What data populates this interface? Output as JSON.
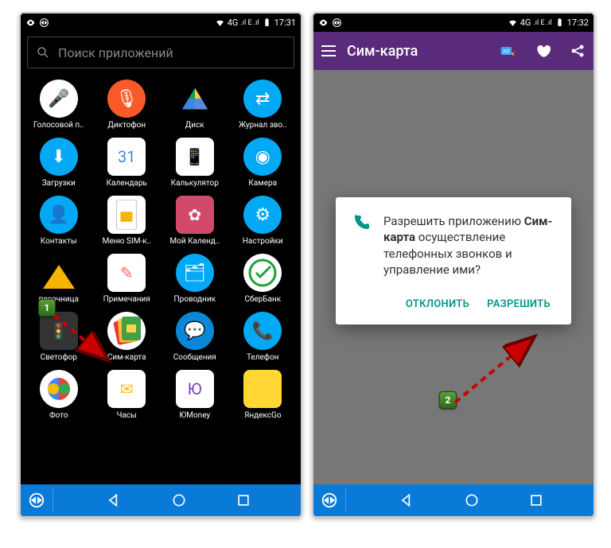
{
  "status": {
    "signal": "4G",
    "bars": ".ıl E .ıl",
    "battery": "",
    "time1": "17:31",
    "time2": "17:32"
  },
  "search": {
    "placeholder": "Поиск приложений"
  },
  "apps": [
    {
      "label": "Голосовой п..",
      "bg": "#fff",
      "glyph": "🎤",
      "fg": "#4285f4"
    },
    {
      "label": "Диктофон",
      "bg": "#f85a2a",
      "glyph": "🎙"
    },
    {
      "label": "Диск",
      "bg": "#000",
      "tri": true
    },
    {
      "label": "Журнал зво..",
      "bg": "#03a9f4",
      "glyph": "⇄"
    },
    {
      "label": "Загрузки",
      "bg": "#03a9f4",
      "glyph": "⬇"
    },
    {
      "label": "Календарь",
      "bg": "#fff",
      "glyph": "31",
      "fg": "#4285f4",
      "box": true
    },
    {
      "label": "Калькулятор",
      "bg": "#fff",
      "glyph": "📱",
      "fg": "#666",
      "box": true
    },
    {
      "label": "Камера",
      "bg": "#03a9f4",
      "glyph": "◉"
    },
    {
      "label": "Контакты",
      "bg": "#03a9f4",
      "glyph": "👤"
    },
    {
      "label": "Меню SIM-к..",
      "bg": "#fff",
      "sim": true,
      "box": true
    },
    {
      "label": "Мой Календ..",
      "bg": "#d14a6b",
      "glyph": "✿",
      "box": true
    },
    {
      "label": "Настройки",
      "bg": "#03a9f4",
      "glyph": "⚙"
    },
    {
      "label": "песочница",
      "bg": "#000",
      "sand": true,
      "box": true
    },
    {
      "label": "Примечания",
      "bg": "#fff",
      "glyph": "✎",
      "fg": "#f66",
      "box": true
    },
    {
      "label": "Проводник",
      "bg": "#03a9f4",
      "glyph": "🗂"
    },
    {
      "label": "СберБанк",
      "bg": "#fff",
      "sber": true
    },
    {
      "label": "Светофор",
      "bg": "#333",
      "glyph": "🚦",
      "box": true
    },
    {
      "label": "Сим-карта",
      "bg": "#fff",
      "simcard": true
    },
    {
      "label": "Сообщения",
      "bg": "#0b87d8",
      "glyph": "💬"
    },
    {
      "label": "Телефон",
      "bg": "#03a9f4",
      "glyph": "📞"
    },
    {
      "label": "Фото",
      "bg": "#fff",
      "photos": true
    },
    {
      "label": "Часы",
      "bg": "#fff",
      "glyph": "✉",
      "fg": "#fbbc05",
      "box": true
    },
    {
      "label": "ЮMoney",
      "bg": "#fff",
      "glyph": "Ю",
      "fg": "#7b3fbf",
      "box": true
    },
    {
      "label": "ЯндексGo",
      "bg": "#ffd633",
      "glyph": "",
      "box": true
    }
  ],
  "screen2": {
    "title": "Сим-карта",
    "dialog_prefix": "Разрешить приложению ",
    "dialog_app": "Сим-карта",
    "dialog_suffix": " осуществление телефонных звонков и управление ими?",
    "deny": "ОТКЛОНИТЬ",
    "allow": "РАЗРЕШИТЬ"
  },
  "badges": {
    "b1": "1",
    "b2": "2"
  }
}
